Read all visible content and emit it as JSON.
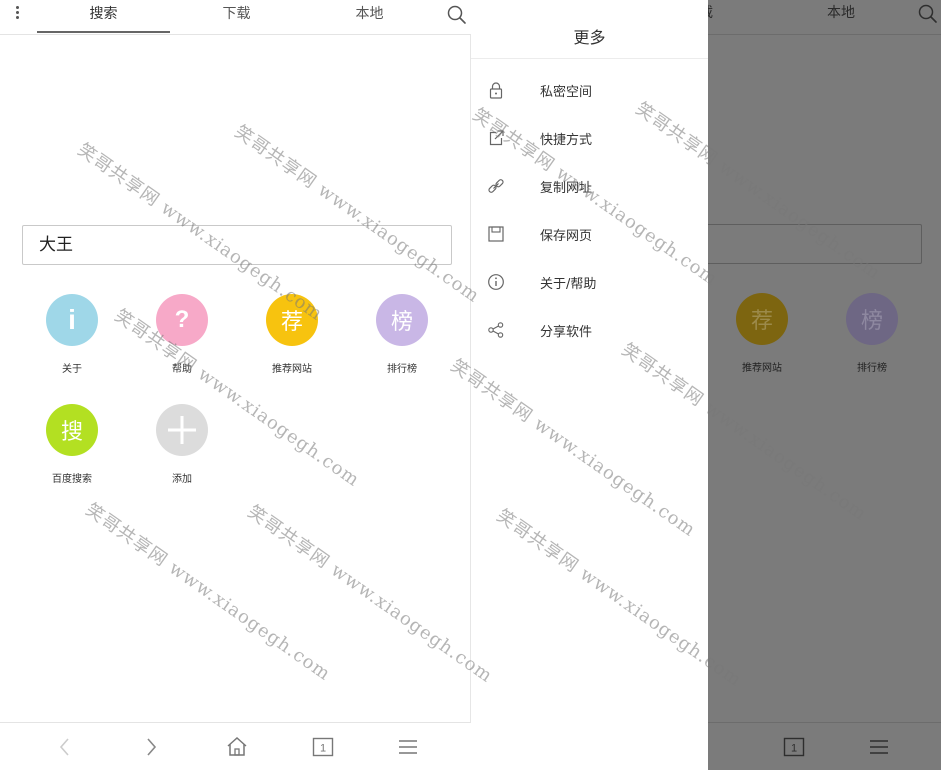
{
  "left": {
    "tabs": [
      {
        "label": "搜索"
      },
      {
        "label": "下载"
      },
      {
        "label": "本地"
      }
    ],
    "search_value": "大王",
    "shortcuts": [
      {
        "glyph": "i",
        "label": "关于",
        "color": "#9fd7e8"
      },
      {
        "glyph": "?",
        "label": "帮助",
        "color": "#f7a9c8"
      },
      {
        "glyph": "荐",
        "label": "推荐网站",
        "color": "#f7c30f"
      },
      {
        "glyph": "榜",
        "label": "排行榜",
        "color": "#c9b7e6"
      },
      {
        "glyph": "搜",
        "label": "百度搜索",
        "color": "#b3e022"
      },
      {
        "glyph": "+",
        "label": "添加",
        "color": "#dcdcdc"
      }
    ]
  },
  "drawer": {
    "title": "更多",
    "items": [
      {
        "label": "私密空间",
        "icon": "lock-icon"
      },
      {
        "label": "快捷方式",
        "icon": "shortcut-icon"
      },
      {
        "label": "复制网址",
        "icon": "link-icon"
      },
      {
        "label": "保存网页",
        "icon": "save-icon"
      },
      {
        "label": "关于/帮助",
        "icon": "info-icon"
      },
      {
        "label": "分享软件",
        "icon": "share-icon"
      }
    ]
  },
  "right": {
    "tabs": [
      {
        "label": "载"
      },
      {
        "label": "本地"
      }
    ],
    "shortcuts": [
      {
        "glyph": "荐",
        "label": "推荐网站",
        "color": "#7d6510"
      },
      {
        "glyph": "榜",
        "label": "排行榜",
        "color": "#6e6784"
      }
    ]
  },
  "watermark": "笑哥共享网 www.xiaogegh.com"
}
